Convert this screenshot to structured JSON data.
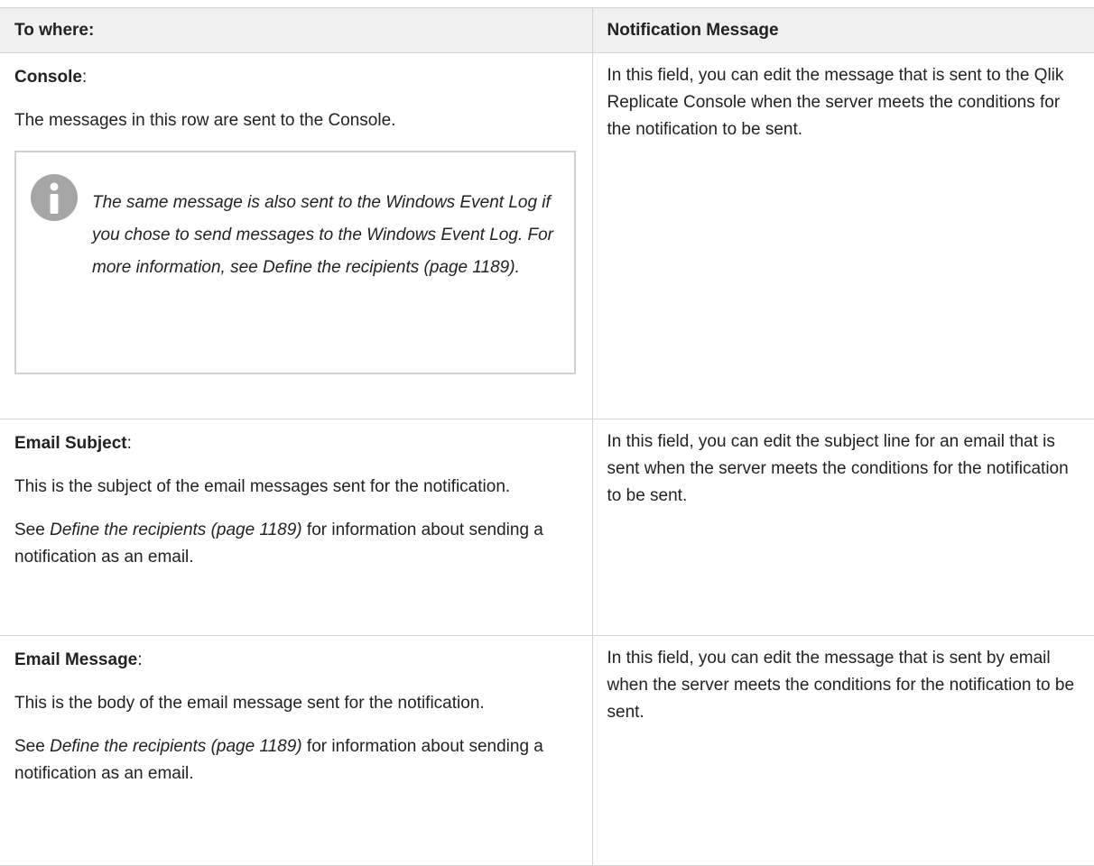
{
  "table": {
    "header": {
      "col1": "To where:",
      "col2": "Notification Message"
    },
    "rows": [
      {
        "label": "Console",
        "label_suffix": ":",
        "description": "The messages in this row are sent to the Console.",
        "note": {
          "icon": "info-icon",
          "text": "The same message is also sent to the Windows Event Log if you chose to send messages to the Windows Event Log. For more information, see Define the recipients (page 1189)."
        },
        "right_text": "In this field, you can edit the message that is sent to the Qlik Replicate Console when the server meets the conditions for the notification to be sent."
      },
      {
        "label": "Email Subject",
        "label_suffix": ":",
        "description": "This is the subject of the email messages sent for the notification.",
        "see_prefix": "See ",
        "see_link": "Define the recipients (page 1189)",
        "see_suffix": " for information about sending a notification as an email.",
        "right_text": "In this field, you can edit the subject line for an email that is sent when the server meets the conditions for the notification to be sent."
      },
      {
        "label": "Email Message",
        "label_suffix": ":",
        "description": "This is the body of the email message sent for the notification.",
        "see_prefix": "See ",
        "see_link": "Define the recipients (page 1189)",
        "see_suffix": " for information about sending a notification as an email.",
        "right_text": "In this field, you can edit the message that is sent by email when the server meets the conditions for the notification to be sent."
      }
    ]
  },
  "colors": {
    "border": "#d4d4d4",
    "header_bg": "#f0f0f0",
    "icon": "#a6a6a6"
  }
}
